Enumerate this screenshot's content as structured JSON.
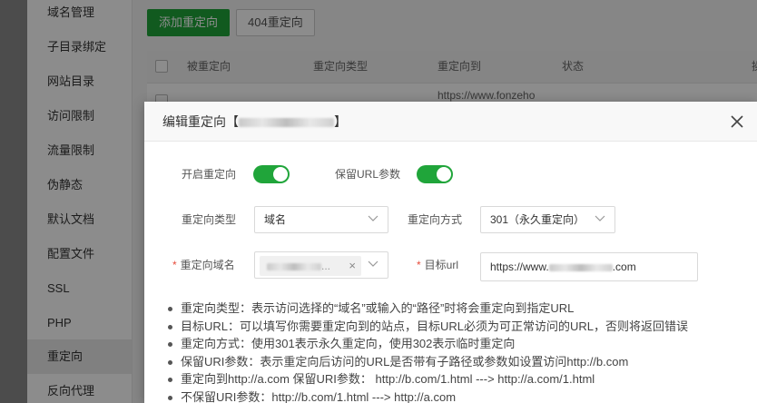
{
  "sidebar": {
    "items": [
      {
        "label": "域名管理"
      },
      {
        "label": "子目录绑定"
      },
      {
        "label": "网站目录"
      },
      {
        "label": "访问限制"
      },
      {
        "label": "流量限制"
      },
      {
        "label": "伪静态"
      },
      {
        "label": "默认文档"
      },
      {
        "label": "配置文件"
      },
      {
        "label": "SSL"
      },
      {
        "label": "PHP"
      },
      {
        "label": "重定向"
      },
      {
        "label": "反向代理"
      }
    ],
    "active": "重定向"
  },
  "toolbar": {
    "add_label": "添加重定向",
    "not_found_label": "404重定向"
  },
  "table": {
    "headers": [
      "被重定向",
      "重定向类型",
      "重定向到",
      "状态",
      "操"
    ],
    "row": {
      "target": "https://www.fonzeho"
    }
  },
  "modal": {
    "title_prefix": "编辑重定向【",
    "title_suffix": "】",
    "enable_label": "开启重定向",
    "keep_url_label": "保留URL参数",
    "type_label": "重定向类型",
    "type_value": "域名",
    "method_label": "重定向方式",
    "method_value": "301（永久重定向）",
    "domain_label": "重定向域名",
    "target_url_label": "目标url",
    "target_url_prefix": "https://www.",
    "target_url_suffix": ".com",
    "tag_suffix": "...",
    "tips": [
      "重定向类型：表示访问选择的“域名”或输入的“路径”时将会重定向到指定URL",
      "目标URL：可以填写你需要重定向到的站点，目标URL必须为可正常访问的URL，否则将返回错误",
      "重定向方式：使用301表示永久重定向，使用302表示临时重定向",
      "保留URI参数：表示重定向后访问的URL是否带有子路径或参数如设置访问http://b.com",
      "重定向到http://a.com 保留URI参数：  http://b.com/1.html ---> http://a.com/1.html",
      "不保留URI参数：http://b.com/1.html ---> http://a.com"
    ]
  },
  "colors": {
    "accent": "#20a53a",
    "required": "#e74c3c"
  }
}
